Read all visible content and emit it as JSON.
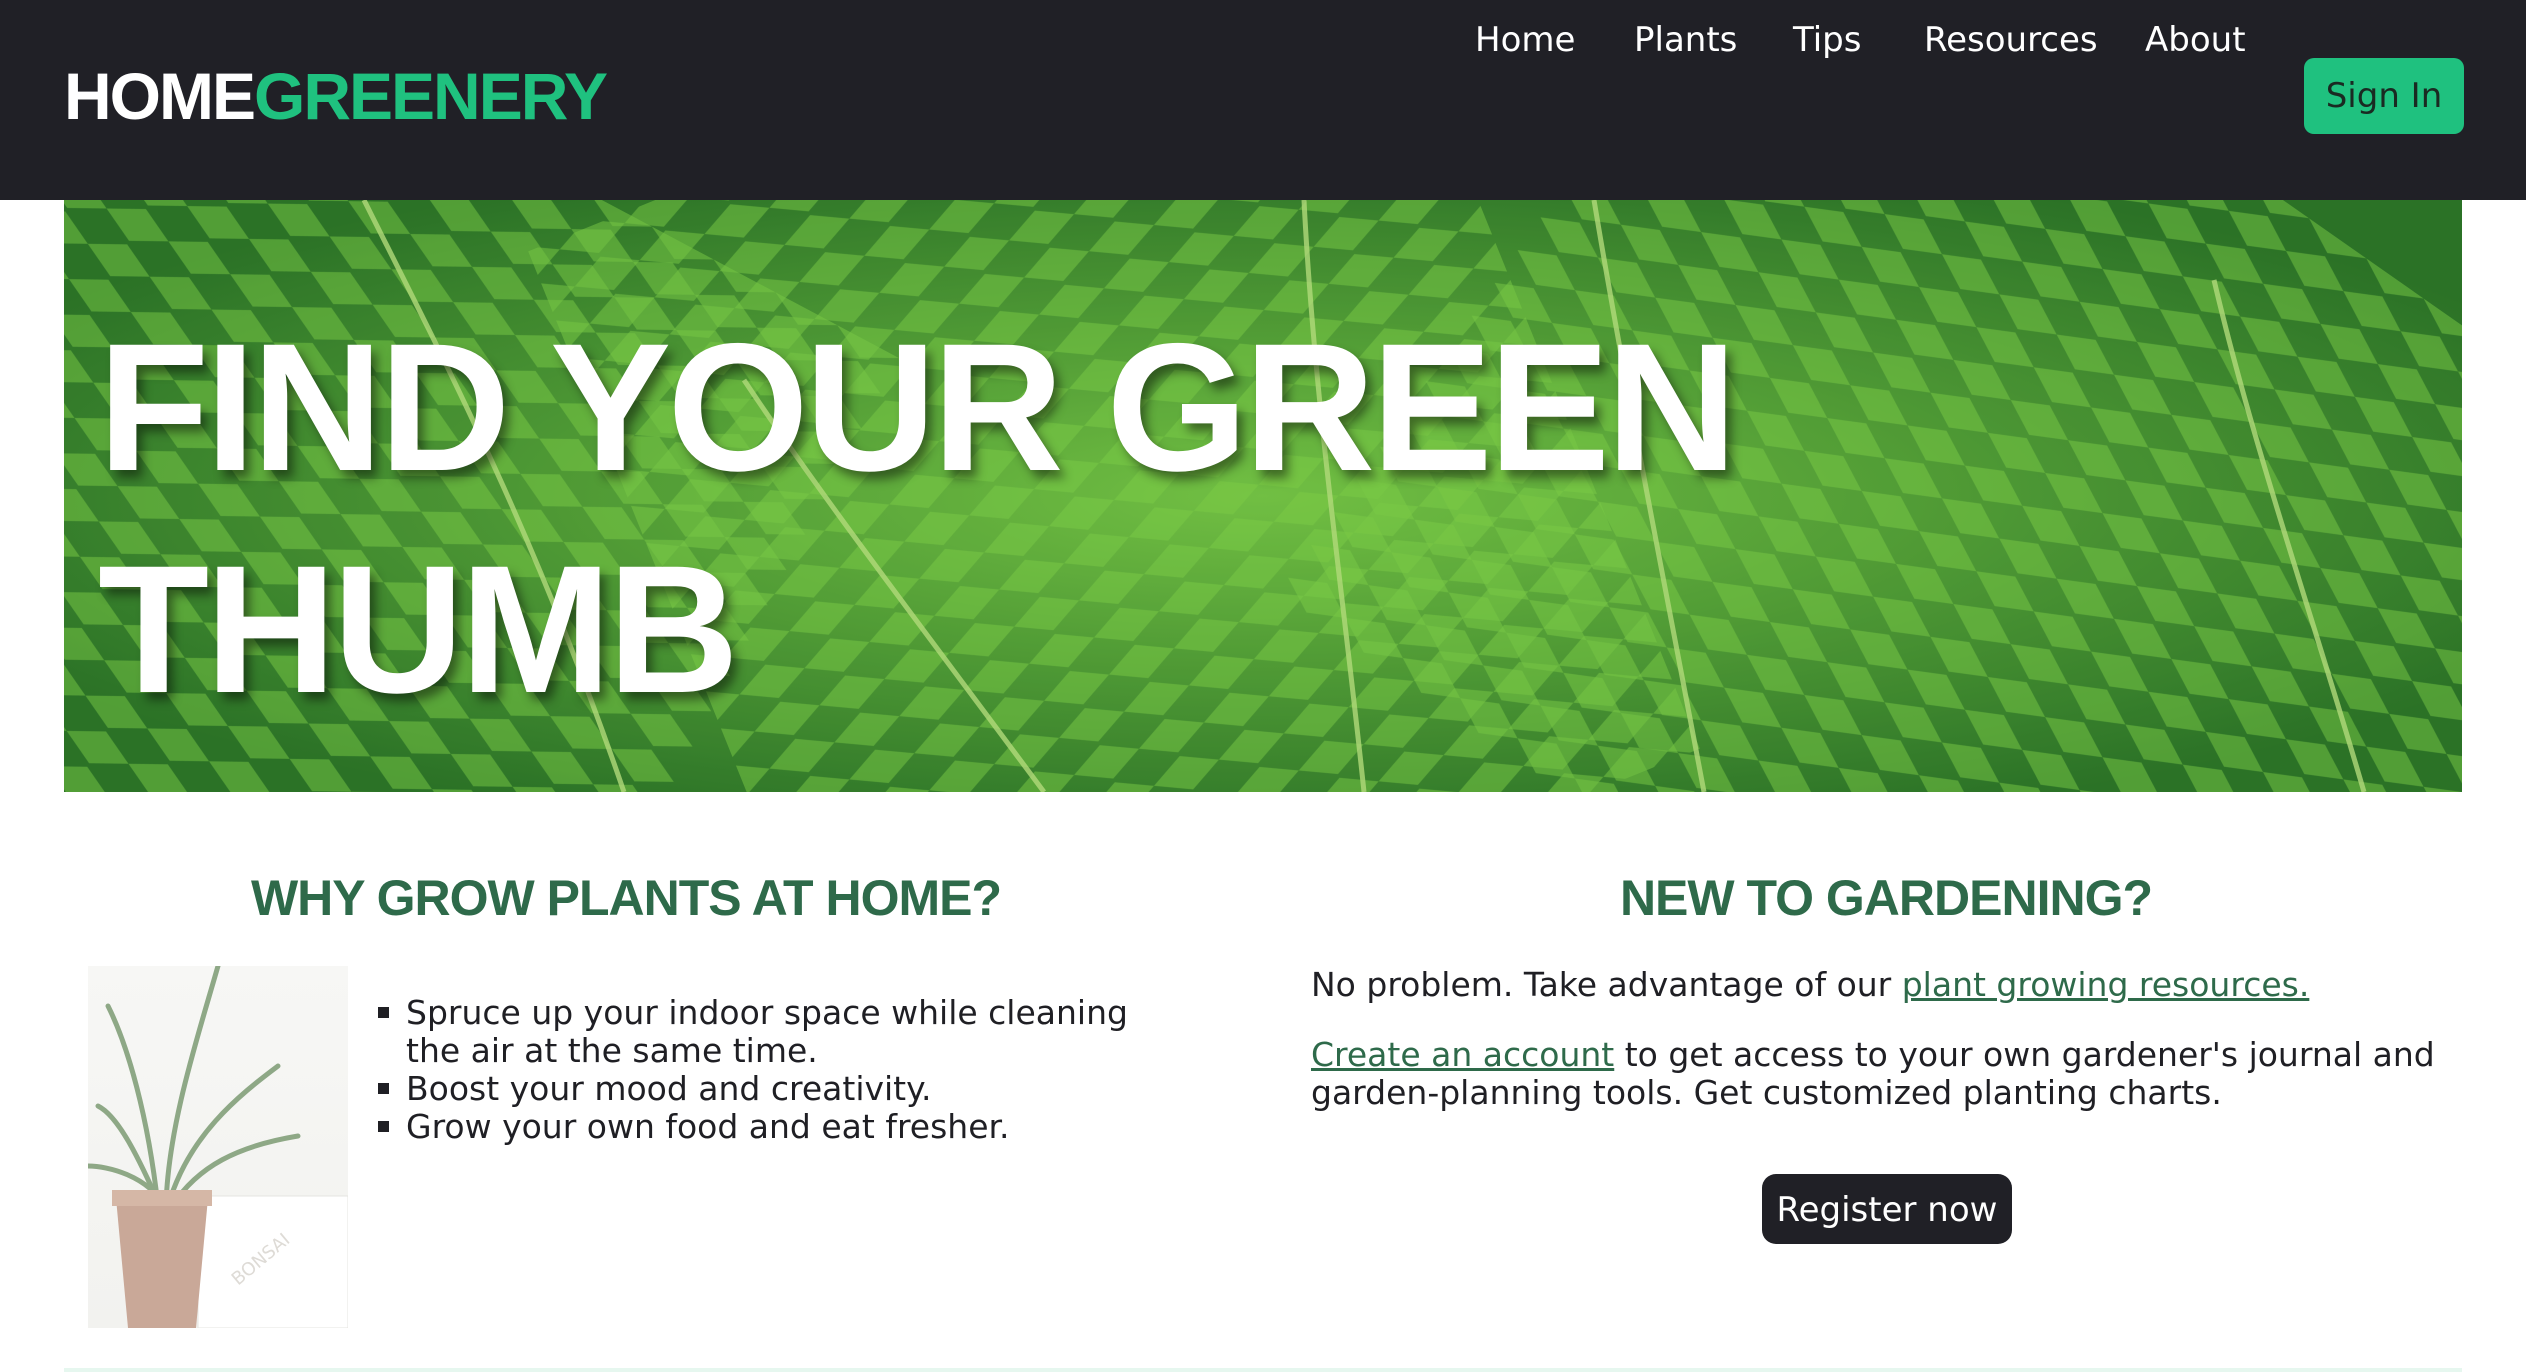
{
  "brand": {
    "part1": "HOME",
    "part2": "GREENERY"
  },
  "nav": {
    "items": [
      {
        "label": "Home"
      },
      {
        "label": "Plants"
      },
      {
        "label": "Tips"
      },
      {
        "label": "Resources"
      },
      {
        "label": "About"
      }
    ],
    "signin_label": "Sign In"
  },
  "hero": {
    "title_line1": "FIND YOUR GREEN",
    "title_line2": "THUMB"
  },
  "why": {
    "heading": "WHY GROW PLANTS AT HOME?",
    "benefits": [
      "Spruce up your indoor space while cleaning the air at the same time.",
      "Boost your mood and creativity.",
      "Grow your own food and eat fresher."
    ]
  },
  "newto": {
    "heading": "NEW TO GARDENING?",
    "para1_prefix": "No problem. Take advantage of our ",
    "para1_link": "plant growing resources.",
    "para2_link": "Create an account",
    "para2_suffix": " to get access to your own gardener's journal and garden-planning tools. Get customized planting charts.",
    "register_label": "Register now"
  },
  "colors": {
    "brand_green": "#1fc17f",
    "heading_green": "#2e6a4a",
    "nav_bg": "#202026"
  }
}
